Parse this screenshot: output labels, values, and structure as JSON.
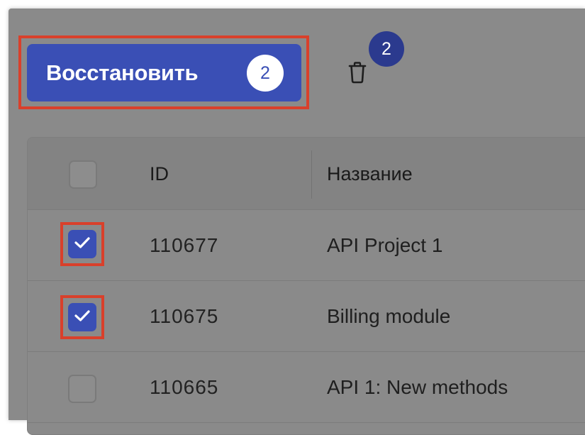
{
  "toolbar": {
    "restore_label": "Восстановить",
    "restore_count": "2",
    "delete_badge_count": "2"
  },
  "table": {
    "columns": [
      "ID",
      "Название"
    ],
    "rows": [
      {
        "id": "110677",
        "name": "API Project 1",
        "checked": true
      },
      {
        "id": "110675",
        "name": "Billing module",
        "checked": true
      },
      {
        "id": "110665",
        "name": "API 1: New methods",
        "checked": false
      }
    ]
  },
  "colors": {
    "accent": "#3a4fb5",
    "badge": "#2b3a8e",
    "highlight": "#d9402b",
    "overlay": "#8a8a8a"
  }
}
